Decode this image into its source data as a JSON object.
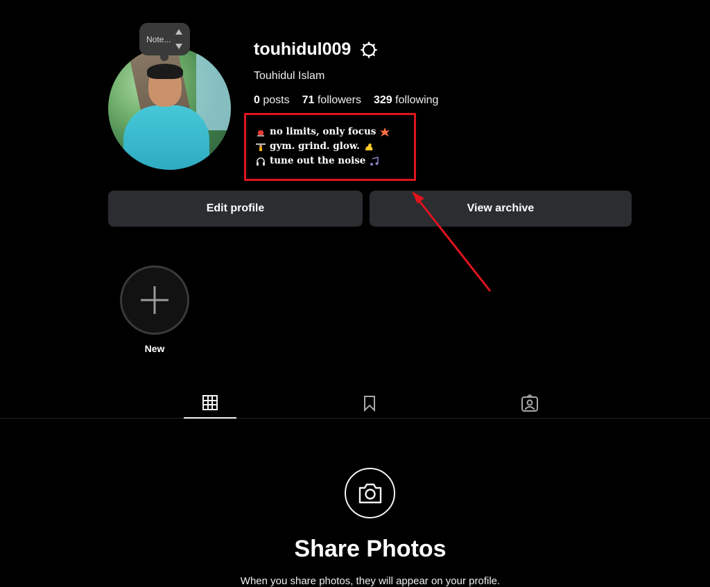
{
  "note": {
    "label": "Note..."
  },
  "profile": {
    "username": "touhidul009",
    "full_name": "Touhidul Islam",
    "stats": {
      "posts_count": "0",
      "posts_label": "posts",
      "followers_count": "71",
      "followers_label": "followers",
      "following_count": "329",
      "following_label": "following"
    },
    "bio": [
      {
        "icon": "siren-icon",
        "text": "no limits, only focus",
        "trail_icon": "explosion-icon"
      },
      {
        "icon": "weightlifter-icon",
        "text": "gym. grind. glow.",
        "trail_icon": "flexed-biceps-icon"
      },
      {
        "icon": "headphones-icon",
        "text": "tune out the noise",
        "trail_icon": "music-notes-icon"
      }
    ]
  },
  "actions": {
    "edit_profile": "Edit profile",
    "view_archive": "View archive"
  },
  "highlights": {
    "new_label": "New"
  },
  "tabs": [
    {
      "name": "posts",
      "icon": "grid-icon",
      "active": true
    },
    {
      "name": "saved",
      "icon": "bookmark-icon",
      "active": false
    },
    {
      "name": "tagged",
      "icon": "tagged-icon",
      "active": false
    }
  ],
  "empty_state": {
    "title": "Share Photos",
    "subtitle": "When you share photos, they will appear on your profile."
  },
  "colors": {
    "background": "#000000",
    "button": "#2b2d31",
    "annotation": "#e0141e"
  }
}
